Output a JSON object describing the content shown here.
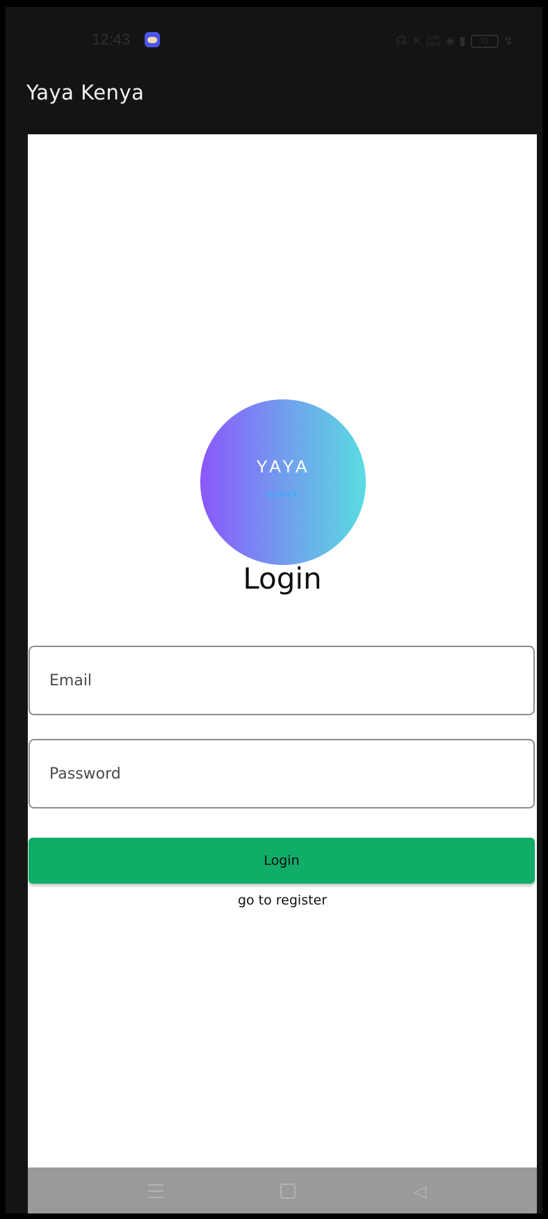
{
  "status_bar": {
    "time": "12:43",
    "net_speed_value": "0.48",
    "net_speed_unit": "KB/S",
    "battery": "72"
  },
  "app_bar": {
    "title": "Yaya Kenya"
  },
  "logo": {
    "main_text": "YAYA",
    "sub_text": "KENYA"
  },
  "page": {
    "title": "Login"
  },
  "form": {
    "email_placeholder": "Email",
    "password_placeholder": "Password",
    "login_label": "Login",
    "register_link": "go to register"
  },
  "colors": {
    "background": "#141414",
    "card": "#ffffff",
    "login_button": "#10ad69",
    "logo_gradient_start": "#8b57fb",
    "logo_gradient_end": "#5adce2"
  },
  "icons": {
    "weather": "weather-cloud-icon",
    "headphones": "headphones-icon",
    "mute": "mute-icon",
    "wifi": "wifi-icon",
    "signal": "signal-icon",
    "battery": "battery-icon",
    "charging": "charging-icon",
    "nav_menu": "menu-icon",
    "nav_home": "home-icon",
    "nav_back": "back-icon"
  }
}
